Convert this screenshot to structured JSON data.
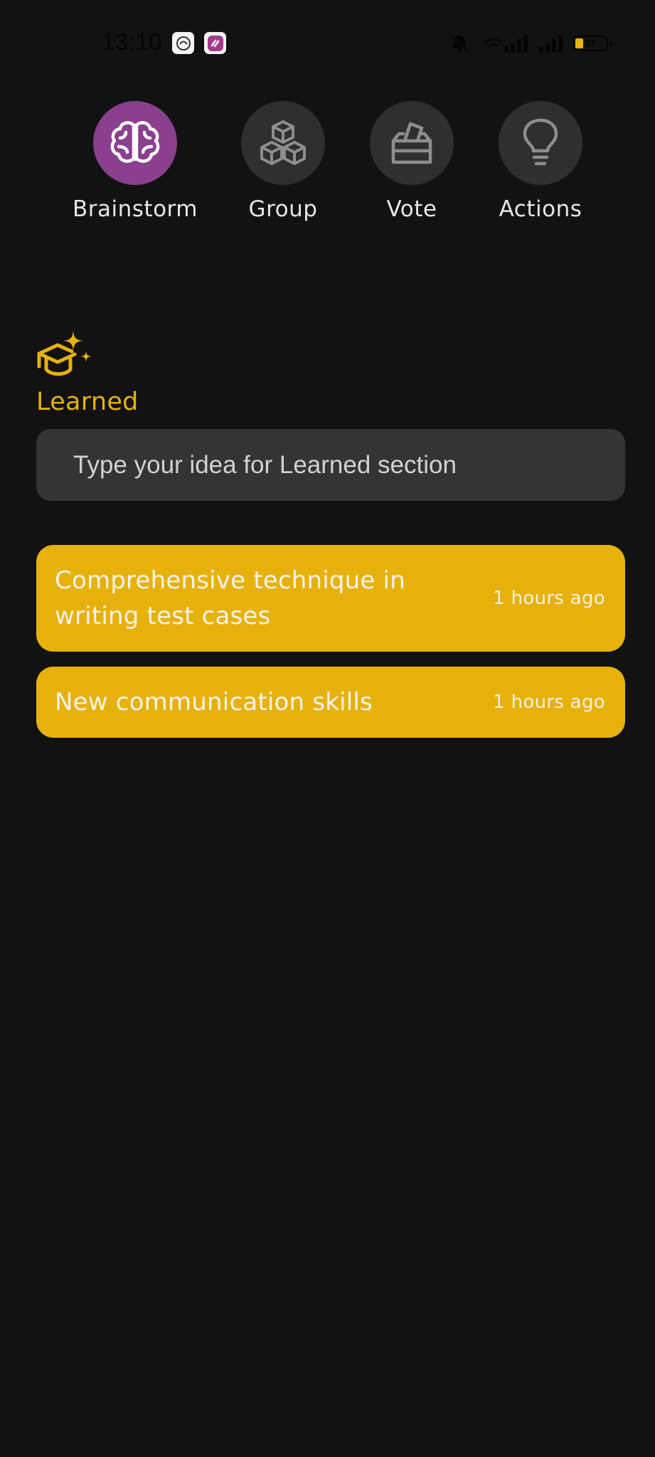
{
  "status_bar": {
    "time": "13:10",
    "battery_level": "23",
    "battery_fraction": 0.23,
    "icons": [
      "app-icon-1",
      "app-icon-2",
      "muted-bell-icon",
      "wifi-signal-icon",
      "cell-signal-icon",
      "cell-signal-icon",
      "battery-icon"
    ]
  },
  "tabs": [
    {
      "label": "Brainstorm",
      "icon": "brain-icon",
      "active": true
    },
    {
      "label": "Group",
      "icon": "cubes-icon",
      "active": false
    },
    {
      "label": "Vote",
      "icon": "ballot-box-icon",
      "active": false
    },
    {
      "label": "Actions",
      "icon": "lightbulb-icon",
      "active": false
    }
  ],
  "section": {
    "title": "Learned",
    "icon": "graduation-cap-sparkle-icon",
    "input_placeholder": "Type your idea for Learned section",
    "input_value": ""
  },
  "ideas": [
    {
      "text": "Comprehensive technique in writing test cases",
      "time": "1 hours ago"
    },
    {
      "text": "New communication skills",
      "time": "1 hours ago"
    }
  ],
  "colors": {
    "background": "#121212",
    "accent_purple": "#8a3f8f",
    "accent_yellow": "#e7b10b",
    "tab_inactive": "#2f2f2f",
    "input_background": "#343434"
  }
}
